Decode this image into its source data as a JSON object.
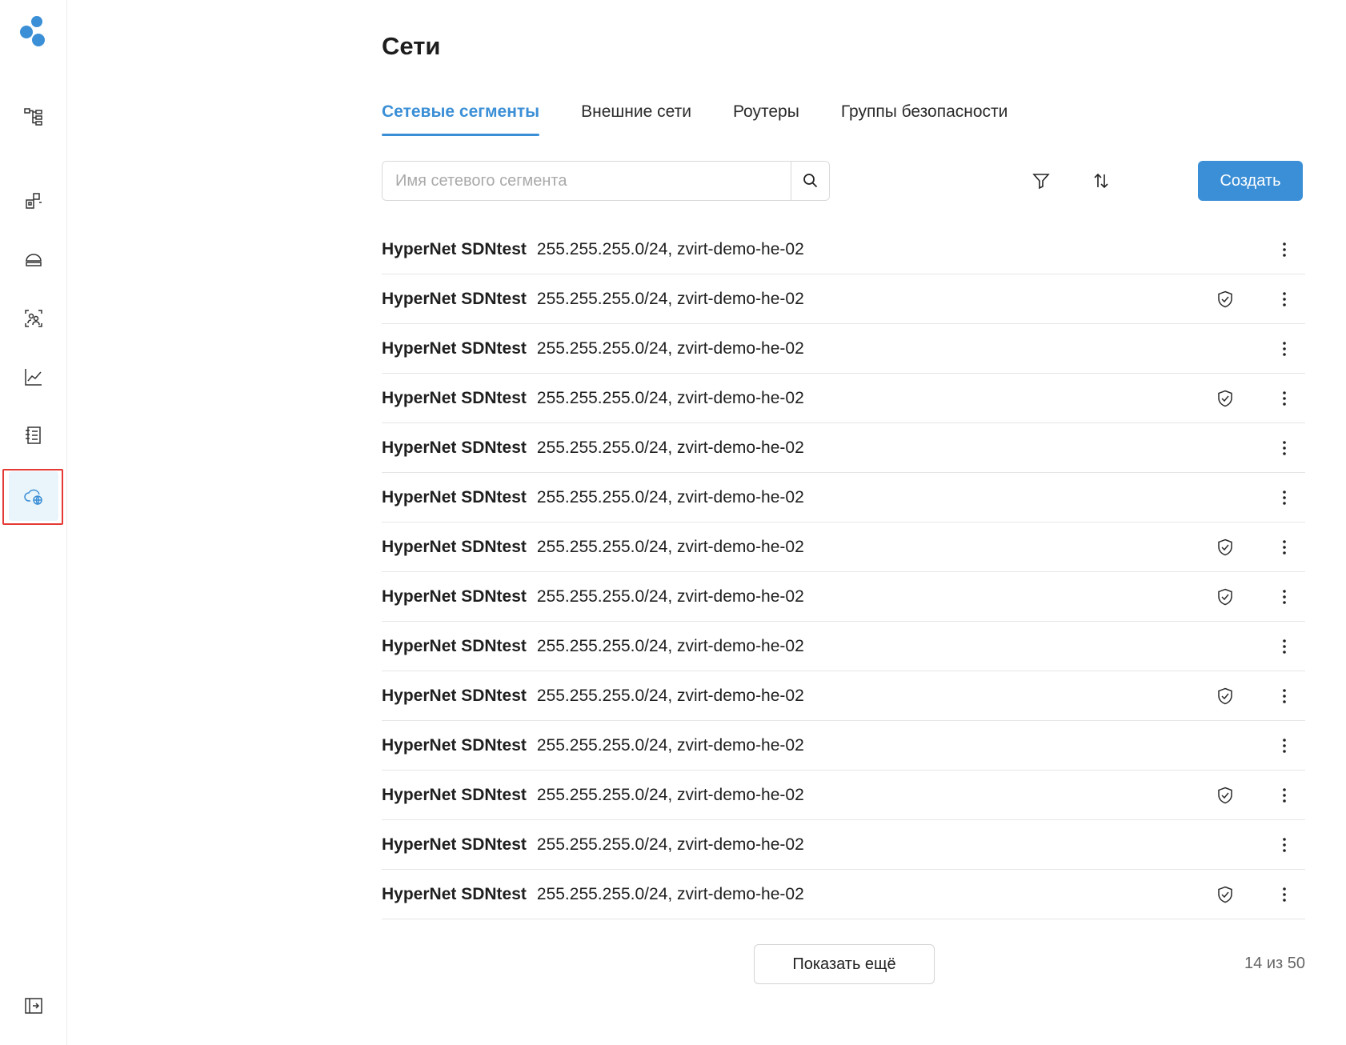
{
  "sidebar": {
    "items": [
      {
        "icon": "hierarchy-tree-icon"
      },
      {
        "icon": "resources-icon"
      },
      {
        "icon": "storage-icon"
      },
      {
        "icon": "users-group-icon"
      },
      {
        "icon": "chart-line-icon"
      },
      {
        "icon": "log-list-icon"
      },
      {
        "icon": "cloud-network-icon",
        "active": true
      },
      {
        "icon": "collapse-sidebar-icon"
      }
    ]
  },
  "header": {
    "title": "Сети"
  },
  "tabs": [
    {
      "label": "Сетевые сегменты",
      "active": true
    },
    {
      "label": "Внешние сети"
    },
    {
      "label": "Роутеры"
    },
    {
      "label": "Группы безопасности"
    }
  ],
  "toolbar": {
    "search_placeholder": "Имя сетевого сегмента",
    "create_label": "Создать"
  },
  "segments": [
    {
      "name": "HyperNet SDNtest",
      "detail": "255.255.255.0/24, zvirt-demo-he-02",
      "secured": false
    },
    {
      "name": "HyperNet SDNtest",
      "detail": "255.255.255.0/24, zvirt-demo-he-02",
      "secured": true
    },
    {
      "name": "HyperNet SDNtest",
      "detail": "255.255.255.0/24, zvirt-demo-he-02",
      "secured": false
    },
    {
      "name": "HyperNet SDNtest",
      "detail": "255.255.255.0/24, zvirt-demo-he-02",
      "secured": true
    },
    {
      "name": "HyperNet SDNtest",
      "detail": "255.255.255.0/24, zvirt-demo-he-02",
      "secured": false
    },
    {
      "name": "HyperNet SDNtest",
      "detail": "255.255.255.0/24, zvirt-demo-he-02",
      "secured": false
    },
    {
      "name": "HyperNet SDNtest",
      "detail": "255.255.255.0/24, zvirt-demo-he-02",
      "secured": true
    },
    {
      "name": "HyperNet SDNtest",
      "detail": "255.255.255.0/24, zvirt-demo-he-02",
      "secured": true
    },
    {
      "name": "HyperNet SDNtest",
      "detail": "255.255.255.0/24, zvirt-demo-he-02",
      "secured": false
    },
    {
      "name": "HyperNet SDNtest",
      "detail": "255.255.255.0/24, zvirt-demo-he-02",
      "secured": true
    },
    {
      "name": "HyperNet SDNtest",
      "detail": "255.255.255.0/24, zvirt-demo-he-02",
      "secured": false
    },
    {
      "name": "HyperNet SDNtest",
      "detail": "255.255.255.0/24, zvirt-demo-he-02",
      "secured": true
    },
    {
      "name": "HyperNet SDNtest",
      "detail": "255.255.255.0/24, zvirt-demo-he-02",
      "secured": false
    },
    {
      "name": "HyperNet SDNtest",
      "detail": "255.255.255.0/24, zvirt-demo-he-02",
      "secured": true
    }
  ],
  "footer": {
    "show_more_label": "Показать ещё",
    "count_text": "14 из 50"
  },
  "colors": {
    "accent": "#3b8fd6",
    "active_bg": "#eaf5fb",
    "highlight": "#e53935"
  }
}
